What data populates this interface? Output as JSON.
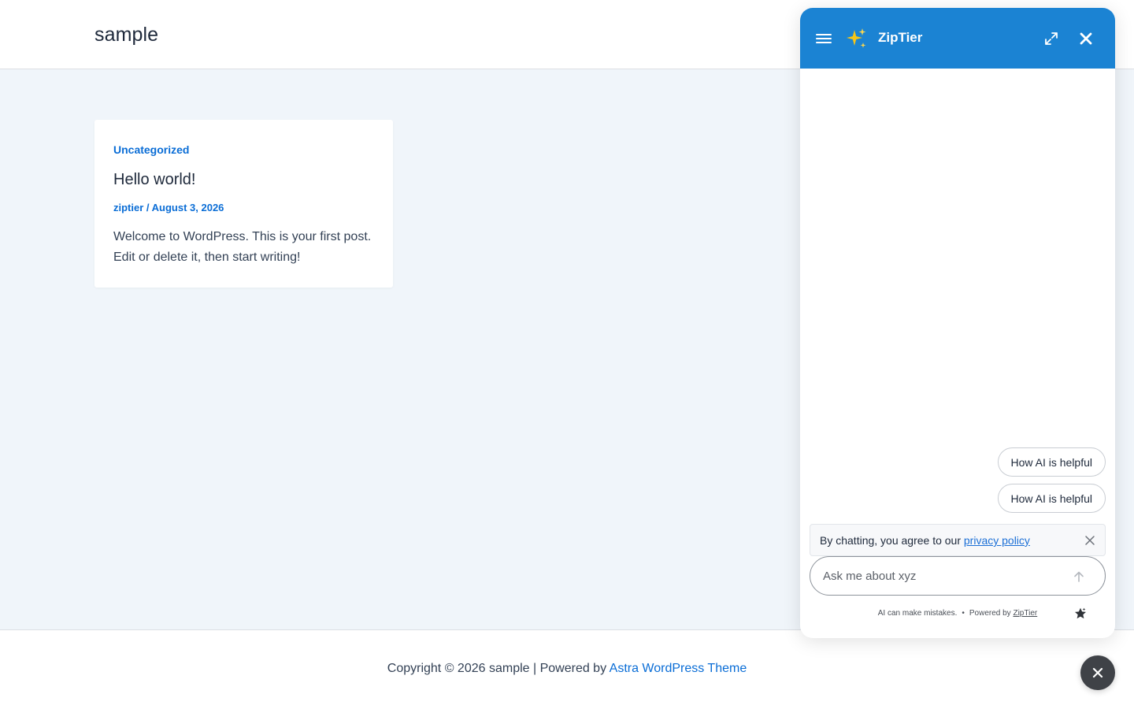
{
  "header": {
    "site_title": "sample"
  },
  "post": {
    "category": "Uncategorized",
    "title": "Hello world!",
    "author": "ziptier",
    "meta_separator": " / ",
    "date": "August 3, 2026",
    "excerpt": "Welcome to WordPress. This is your first post. Edit or delete it, then start writing!"
  },
  "footer": {
    "copyright": "Copyright © 2026 sample | Powered by ",
    "theme_link": "Astra WordPress Theme"
  },
  "chat": {
    "title": "ZipTier",
    "accent_color": "#1b83d3",
    "suggestions": [
      "How AI is helpful",
      "How AI is helpful"
    ],
    "consent_prefix": "By chatting, you agree to our ",
    "consent_link": "privacy policy",
    "input_placeholder": "Ask me about xyz",
    "disclaimer": "AI can make mistakes.",
    "separator": "•",
    "powered_by_prefix": "Powered by ",
    "powered_by_link": "ZipTier",
    "icons": {
      "menu": "hamburger-menu-icon",
      "logo": "sparkles-icon",
      "expand": "expand-icon",
      "close": "close-icon",
      "send": "arrow-up-icon",
      "rate": "star-icon",
      "launcher": "close-icon"
    }
  }
}
